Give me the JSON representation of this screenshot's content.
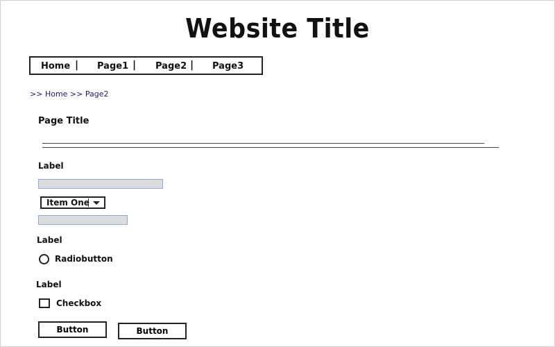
{
  "header": {
    "site_title": "Website Title"
  },
  "nav": {
    "items": [
      {
        "label": "Home"
      },
      {
        "label": "Page1"
      },
      {
        "label": "Page2"
      },
      {
        "label": "Page3"
      }
    ],
    "separator": "|"
  },
  "breadcrumb": {
    "prefix": ">> ",
    "items": [
      "Home",
      "Page2"
    ],
    "separator": " >> "
  },
  "main": {
    "page_title": "Page Title",
    "form": {
      "label_1": "Label",
      "text_input_1_value": "",
      "select_value": "Item One",
      "text_input_2_value": "",
      "label_2": "Label",
      "radio_label": "Radiobutton",
      "label_3": "Label",
      "checkbox_label": "Checkbox",
      "button_1_label": "Button",
      "button_2_label": "Button"
    }
  },
  "colors": {
    "input_fill": "#dcdcdc",
    "input_border": "#8fa8e0",
    "breadcrumb_text": "#1a1a66"
  }
}
